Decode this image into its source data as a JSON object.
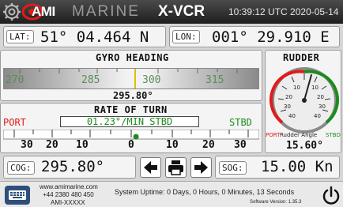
{
  "header": {
    "brand": "AMI",
    "division": "MARINE",
    "product": "X-VCR",
    "datetime": "10:39:12 UTC 2020-05-14",
    "icons": [
      "gear-icon",
      "ami-logo"
    ]
  },
  "position": {
    "lat_label": "LAT:",
    "lat_value": "51° 04.464 N",
    "lon_label": "LON:",
    "lon_value": "001° 29.910 E"
  },
  "gyro": {
    "title": "GYRO HEADING",
    "tape_labels": [
      "270",
      "285",
      "300",
      "315"
    ],
    "value": "295.80°"
  },
  "rate_of_turn": {
    "title": "RATE OF TURN",
    "port_label": "PORT",
    "stbd_label": "STBD",
    "value": "01.23°/MIN STBD",
    "scale_labels": [
      "30",
      "20",
      "10",
      "0",
      "10",
      "20",
      "30"
    ],
    "scale_value": 1.23
  },
  "rudder": {
    "title": "RUDDER",
    "dial_labels": [
      "10",
      "10",
      "20",
      "20",
      "30",
      "30",
      "40",
      "40"
    ],
    "port_label": "PORT",
    "caption": "Rudder Angle",
    "stbd_label": "STBD",
    "value": "15.60°",
    "angle_deg": 15.6
  },
  "nav": {
    "cog_label": "COG:",
    "cog_value": "295.80°",
    "sog_label": "SOG:",
    "sog_value": "15.00 Kn",
    "prev_icon": "arrow-left-icon",
    "print_icon": "printer-icon",
    "next_icon": "arrow-right-icon"
  },
  "footer": {
    "website": "www.amimarine.com",
    "phone": "+44 2380 480 450",
    "code": "AMI-XXXXX",
    "uptime": "System Uptime: 0 Days, 0 Hours, 0 Minutes, 13 Seconds",
    "version": "Software Version: 1.35.3",
    "icons": [
      "keyboard-icon",
      "power-icon"
    ]
  },
  "colors": {
    "accent_red": "#e01b1b",
    "accent_green": "#1f8a1f",
    "header_bg": "#2a2a2a",
    "tape_pointer": "#e0c000"
  }
}
